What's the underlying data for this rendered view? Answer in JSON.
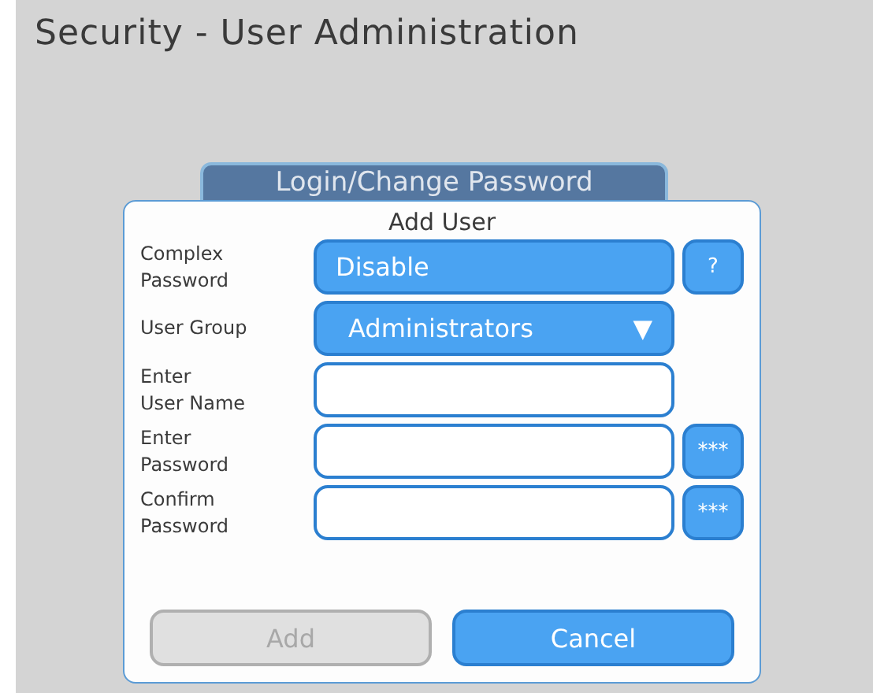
{
  "title": "Security - User Administration",
  "background_button": {
    "label": "Login/Change Password"
  },
  "dialog": {
    "title": "Add User",
    "rows": [
      {
        "kind": "toggle",
        "label": "Complex\nPassword",
        "value": "Disable",
        "side_button": "?"
      },
      {
        "kind": "dropdown",
        "label": "User Group",
        "value": "Administrators",
        "caret": "▼"
      },
      {
        "kind": "input",
        "label": "Enter\nUser Name"
      },
      {
        "kind": "input",
        "label": "Enter\nPassword",
        "side_button": "***"
      },
      {
        "kind": "input",
        "label": "Confirm\nPassword",
        "side_button": "***"
      }
    ],
    "buttons": [
      {
        "label": "Add",
        "disabled": true
      },
      {
        "label": "Cancel",
        "disabled": false
      }
    ]
  }
}
